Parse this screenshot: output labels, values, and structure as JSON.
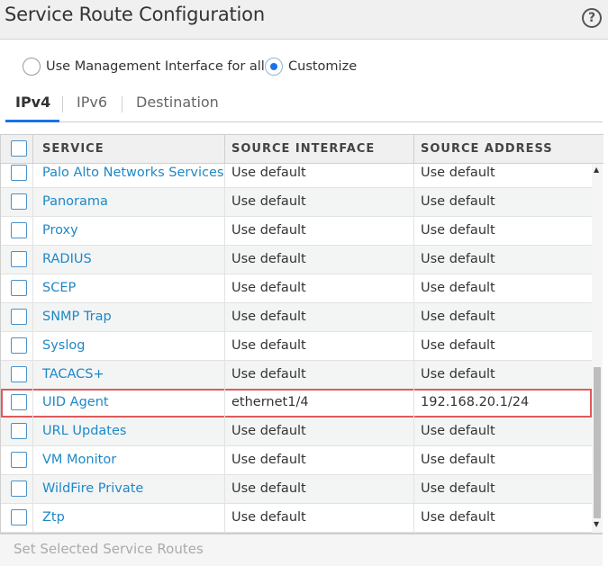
{
  "window": {
    "title": "Service Route Configuration",
    "help_icon": "question-circle-icon"
  },
  "mode": {
    "options": [
      {
        "label": "Use Management Interface for all",
        "checked": false
      },
      {
        "label": "Customize",
        "checked": true
      }
    ]
  },
  "tabs": [
    {
      "label": "IPv4",
      "active": true
    },
    {
      "label": "IPv6",
      "active": false
    },
    {
      "label": "Destination",
      "active": false
    }
  ],
  "table": {
    "columns": [
      "SERVICE",
      "SOURCE INTERFACE",
      "SOURCE ADDRESS"
    ],
    "rows": [
      {
        "service": "Palo Alto Networks Services",
        "source_interface": "Use default",
        "source_address": "Use default"
      },
      {
        "service": "Panorama",
        "source_interface": "Use default",
        "source_address": "Use default"
      },
      {
        "service": "Proxy",
        "source_interface": "Use default",
        "source_address": "Use default"
      },
      {
        "service": "RADIUS",
        "source_interface": "Use default",
        "source_address": "Use default"
      },
      {
        "service": "SCEP",
        "source_interface": "Use default",
        "source_address": "Use default"
      },
      {
        "service": "SNMP Trap",
        "source_interface": "Use default",
        "source_address": "Use default"
      },
      {
        "service": "Syslog",
        "source_interface": "Use default",
        "source_address": "Use default"
      },
      {
        "service": "TACACS+",
        "source_interface": "Use default",
        "source_address": "Use default"
      },
      {
        "service": "UID Agent",
        "source_interface": "ethernet1/4",
        "source_address": "192.168.20.1/24",
        "highlighted": true
      },
      {
        "service": "URL Updates",
        "source_interface": "Use default",
        "source_address": "Use default"
      },
      {
        "service": "VM Monitor",
        "source_interface": "Use default",
        "source_address": "Use default"
      },
      {
        "service": "WildFire Private",
        "source_interface": "Use default",
        "source_address": "Use default"
      },
      {
        "service": "Ztp",
        "source_interface": "Use default",
        "source_address": "Use default"
      }
    ]
  },
  "footer": {
    "action_label": "Set Selected Service Routes",
    "enabled": false
  },
  "colors": {
    "link": "#1e88c7",
    "accent": "#1a73e8",
    "highlight_border": "#e05a5a"
  }
}
